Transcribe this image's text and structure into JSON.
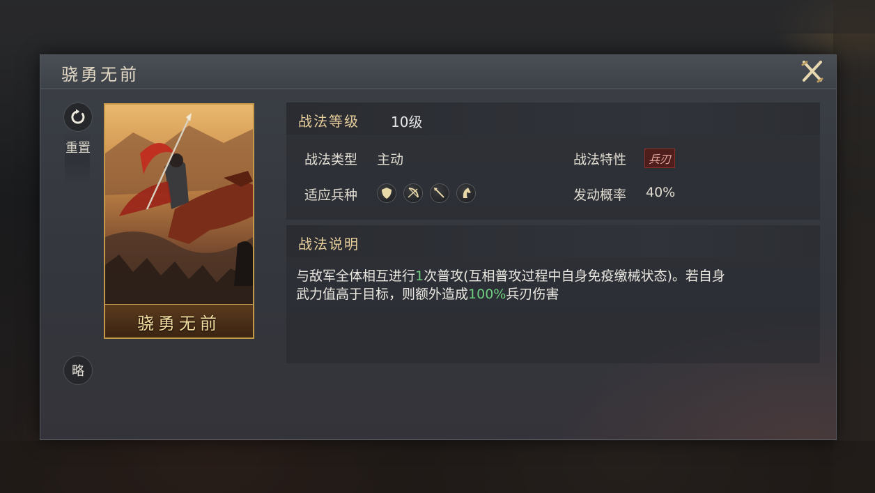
{
  "dialog": {
    "title": "骁勇无前",
    "close_icon": "close-x-icon"
  },
  "side": {
    "reset_label": "重置",
    "brief_label": "略"
  },
  "card": {
    "name": "骁勇无前"
  },
  "info": {
    "level_label": "战法等级",
    "level_value": "10级",
    "type_label": "战法类型",
    "type_value": "主动",
    "trait_label": "战法特性",
    "trait_value": "兵刃",
    "troop_label": "适应兵种",
    "troop_icons": [
      "shield-icon",
      "bow-icon",
      "spear-icon",
      "horse-icon"
    ],
    "rate_label": "发动概率",
    "rate_value": "40%"
  },
  "description": {
    "header": "战法说明",
    "line1_a": "与敌军全体相互进行",
    "line1_hl": "1",
    "line1_b": "次普攻(互相普攻过程中自身免疫缴械状态)。若自身",
    "line2_a": "武力值高于目标，则额外造成",
    "line2_hl": "100%",
    "line2_b": "兵刃伤害"
  },
  "colors": {
    "gold_label": "#e8cf9c",
    "highlight_green": "#6fcf80",
    "card_border": "#c49a48",
    "blade_tag": "#8a2f2a"
  }
}
